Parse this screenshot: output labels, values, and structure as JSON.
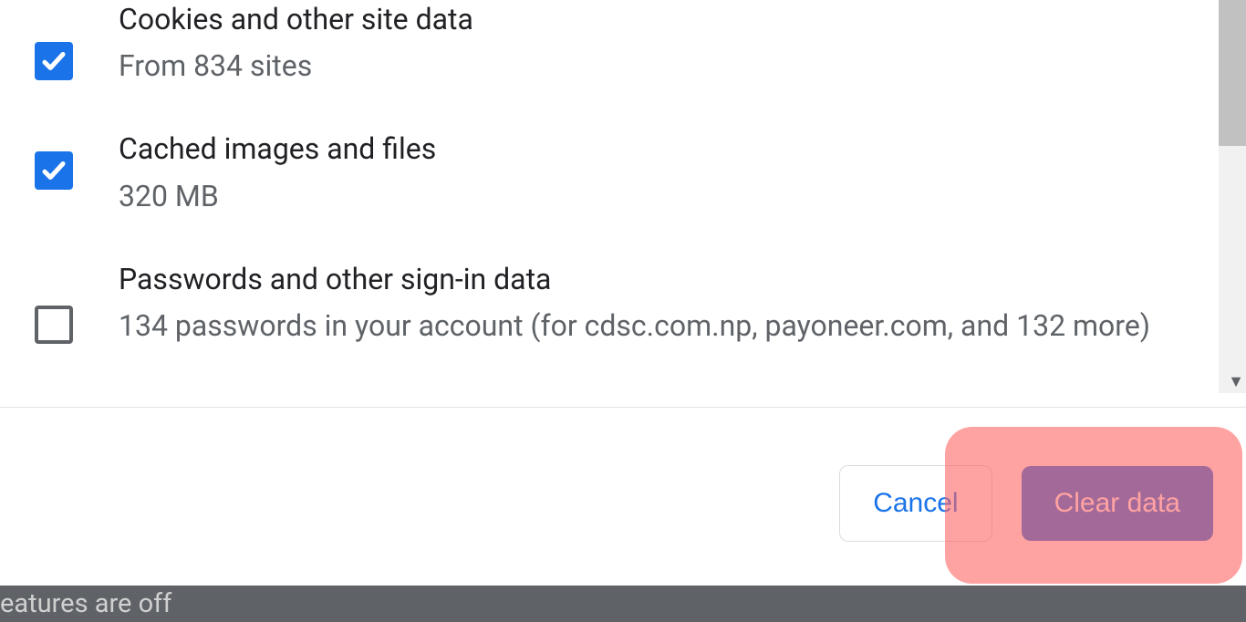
{
  "options": {
    "cookies": {
      "title": "Cookies and other site data",
      "subtitle": "From 834 sites",
      "checked": true
    },
    "cached": {
      "title": "Cached images and files",
      "subtitle": "320 MB",
      "checked": true
    },
    "passwords": {
      "title": "Passwords and other sign-in data",
      "subtitle": "134 passwords in your account (for cdsc.com.np, payoneer.com, and 132 more)",
      "checked": false
    }
  },
  "buttons": {
    "cancel": "Cancel",
    "clear": "Clear data"
  },
  "footer": {
    "text": "eatures are off"
  }
}
